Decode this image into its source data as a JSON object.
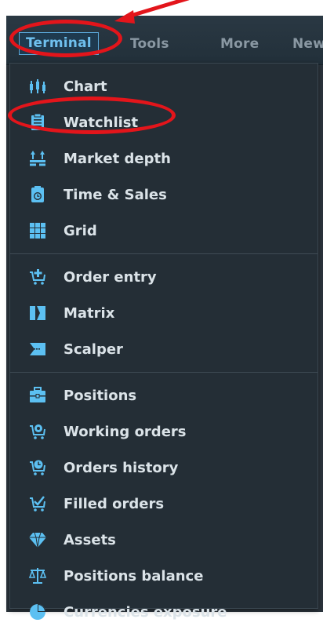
{
  "menubar": {
    "items": [
      {
        "label": "Terminal",
        "active": true
      },
      {
        "label": "Tools"
      },
      {
        "label": "More"
      },
      {
        "label": "New"
      }
    ]
  },
  "menu": {
    "sections": [
      {
        "items": [
          {
            "label": "Chart",
            "icon": "chart-icon"
          },
          {
            "label": "Watchlist",
            "icon": "watchlist-icon"
          },
          {
            "label": "Market depth",
            "icon": "market-depth-icon"
          },
          {
            "label": "Time & Sales",
            "icon": "time-sales-icon"
          },
          {
            "label": "Grid",
            "icon": "grid-icon"
          }
        ]
      },
      {
        "items": [
          {
            "label": "Order entry",
            "icon": "order-entry-icon"
          },
          {
            "label": "Matrix",
            "icon": "matrix-icon"
          },
          {
            "label": "Scalper",
            "icon": "scalper-icon"
          }
        ]
      },
      {
        "items": [
          {
            "label": "Positions",
            "icon": "positions-icon"
          },
          {
            "label": "Working orders",
            "icon": "working-orders-icon"
          },
          {
            "label": "Orders history",
            "icon": "orders-history-icon"
          },
          {
            "label": "Filled orders",
            "icon": "filled-orders-icon"
          },
          {
            "label": "Assets",
            "icon": "assets-icon"
          },
          {
            "label": "Positions balance",
            "icon": "positions-balance-icon"
          },
          {
            "label": "Currencies exposure",
            "icon": "currencies-exposure-icon"
          }
        ]
      }
    ]
  },
  "colors": {
    "accent": "#6fc0ee",
    "annotation": "#e3151b",
    "menu_bg": "#242e36",
    "text": "#dbe3e8"
  }
}
